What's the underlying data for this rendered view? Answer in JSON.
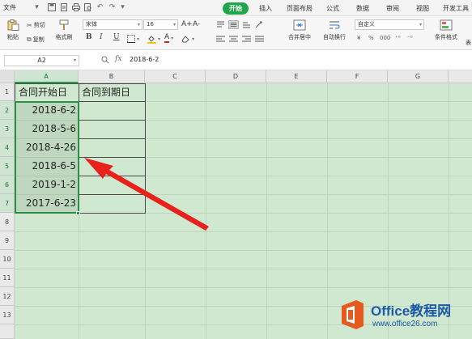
{
  "menu": {
    "file": "文件",
    "tabs": [
      "开始",
      "插入",
      "页面布局",
      "公式",
      "数据",
      "审阅",
      "视图",
      "开发工具"
    ],
    "active_tab": "开始",
    "accent": "#1fa64a"
  },
  "ribbon": {
    "paste": "粘贴",
    "cut": "剪切",
    "copy": "复制",
    "format_painter": "格式刷",
    "font_name": "宋体",
    "font_size": "16",
    "font_grow": "A+",
    "font_shrink": "A-",
    "bold": "B",
    "italic": "I",
    "underline": "U",
    "merge_center": "合并居中",
    "auto_wrap": "自动换行",
    "number_format": "自定义",
    "conditional_format": "条件格式",
    "more": "表"
  },
  "formula_bar": {
    "name_box": "A2",
    "fx": "fx",
    "value": "2018-6-2"
  },
  "sheet": {
    "columns": [
      "A",
      "B",
      "C",
      "D",
      "E",
      "F",
      "G"
    ],
    "rows": [
      "1",
      "2",
      "3",
      "4",
      "5",
      "6",
      "7",
      "8",
      "9",
      "10",
      "11",
      "12",
      "13"
    ],
    "header": [
      "合同开始日",
      "合同到期日"
    ],
    "dates": [
      "2018-6-2",
      "2018-5-6",
      "2018-4-26",
      "2018-6-5",
      "2019-1-2",
      "2017-6-23"
    ]
  },
  "watermark": {
    "title": "Office教程网",
    "url": "www.office26.com"
  }
}
